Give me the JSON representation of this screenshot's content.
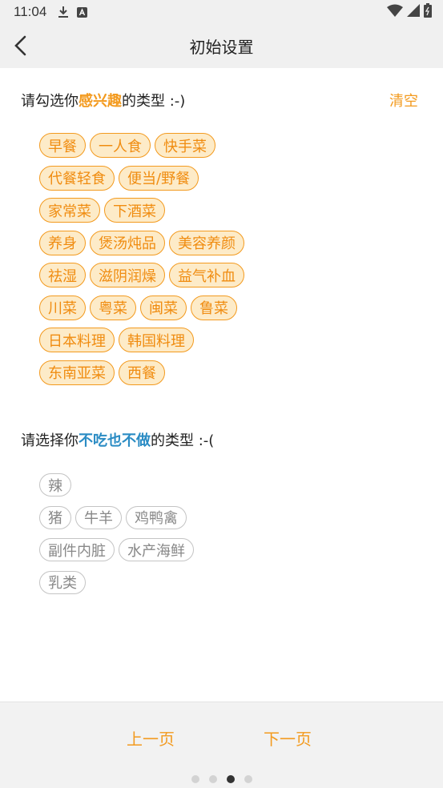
{
  "status_bar": {
    "time": "11:04",
    "icons": [
      "download-icon",
      "accessibility-a-icon",
      "wifi-icon",
      "signal-icon",
      "battery-icon"
    ]
  },
  "app_bar": {
    "title": "初始设置",
    "back_icon": "chevron-left-icon"
  },
  "like_section": {
    "prefix": "请勾选你",
    "highlight": "感兴趣",
    "suffix": "的类型 :-)",
    "clear_label": "清空",
    "rows": [
      [
        "早餐",
        "一人食",
        "快手菜"
      ],
      [
        "代餐轻食",
        "便当/野餐"
      ],
      [
        "家常菜",
        "下酒菜"
      ],
      [
        "养身",
        "煲汤炖品",
        "美容养颜"
      ],
      [
        "祛湿",
        "滋阴润燥",
        "益气补血"
      ],
      [
        "川菜",
        "粤菜",
        "闽菜",
        "鲁菜"
      ],
      [
        "日本料理",
        "韩国料理"
      ],
      [
        "东南亚菜",
        "西餐"
      ]
    ]
  },
  "dislike_section": {
    "prefix": "请选择你",
    "highlight": "不吃也不做",
    "suffix": "的类型 :-(",
    "rows": [
      [
        "辣"
      ],
      [
        "猪",
        "牛羊",
        "鸡鸭禽"
      ],
      [
        "副件内脏",
        "水产海鲜"
      ],
      [
        "乳类"
      ]
    ]
  },
  "bottom_nav": {
    "prev_label": "上一页",
    "next_label": "下一页",
    "page_count": 4,
    "current_page": 3
  },
  "colors": {
    "accent": "#f39a1e",
    "tag_fill": "#fdebc8",
    "highlight_blue": "#2b8cc4",
    "dislike_border": "#c4c4c4"
  }
}
